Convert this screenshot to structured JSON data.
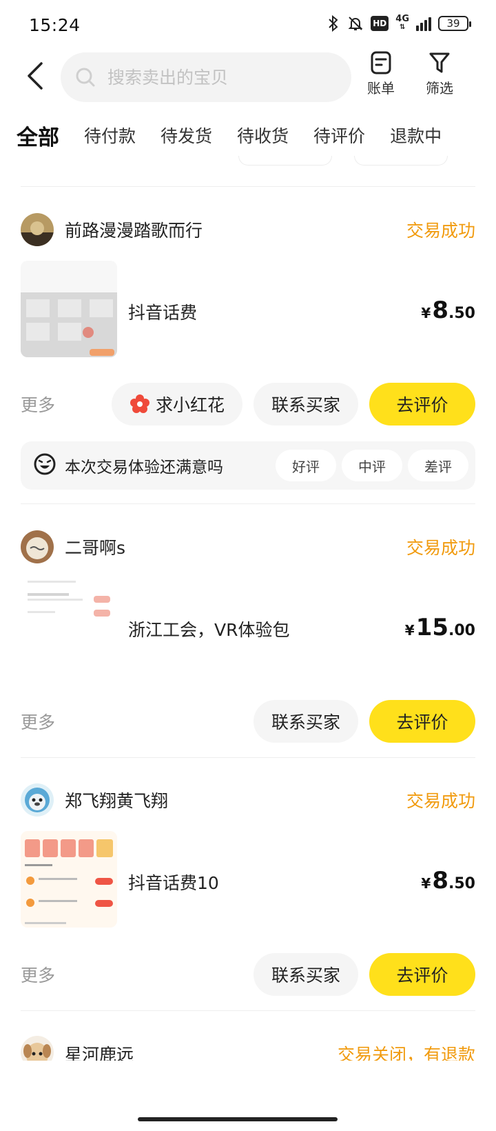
{
  "status_bar": {
    "time": "15:24",
    "network": "4G",
    "hd": "HD",
    "battery": "39"
  },
  "header": {
    "search_placeholder": "搜索卖出的宝贝",
    "bill_label": "账单",
    "filter_label": "筛选"
  },
  "tabs": [
    {
      "label": "全部",
      "active": true
    },
    {
      "label": "待付款"
    },
    {
      "label": "待发货"
    },
    {
      "label": "待收货"
    },
    {
      "label": "待评价"
    },
    {
      "label": "退款中"
    }
  ],
  "orders": [
    {
      "user": "前路漫漫踏歌而行",
      "status": "交易成功",
      "title": "抖音话费",
      "price": {
        "currency": "¥",
        "integer": "8",
        "decimal": ".50"
      },
      "more": "更多",
      "buttons": {
        "flower": "求小红花",
        "contact": "联系买家",
        "review": "去评价"
      },
      "rating": {
        "question": "本次交易体验还满意吗",
        "options": [
          "好评",
          "中评",
          "差评"
        ]
      }
    },
    {
      "user": "二哥啊s",
      "status": "交易成功",
      "title": "浙江工会，VR体验包",
      "price": {
        "currency": "¥",
        "integer": "15",
        "decimal": ".00"
      },
      "more": "更多",
      "buttons": {
        "contact": "联系买家",
        "review": "去评价"
      }
    },
    {
      "user": "郑飞翔黄飞翔",
      "status": "交易成功",
      "title": "抖音话费10",
      "price": {
        "currency": "¥",
        "integer": "8",
        "decimal": ".50"
      },
      "more": "更多",
      "buttons": {
        "contact": "联系买家",
        "review": "去评价"
      }
    },
    {
      "user": "星河鹿远",
      "status": "交易关闭，有退款"
    }
  ],
  "colors": {
    "accent": "#ffe01b",
    "status_orange": "#f19b0f",
    "muted": "#999999"
  }
}
